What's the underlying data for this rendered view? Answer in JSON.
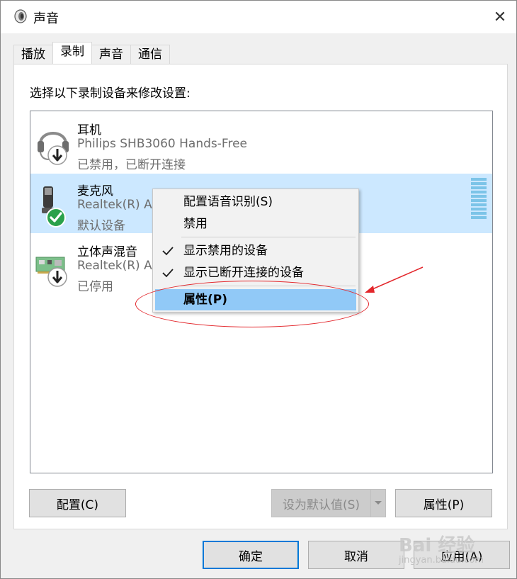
{
  "window": {
    "title": "声音",
    "title_icon": "speaker-icon",
    "close_glyph": "✕"
  },
  "tabs": [
    {
      "label": "播放"
    },
    {
      "label": "录制"
    },
    {
      "label": "声音"
    },
    {
      "label": "通信"
    }
  ],
  "panel": {
    "instruction": "选择以下录制设备来修改设置:"
  },
  "devices": [
    {
      "name": "耳机",
      "description": "Philips SHB3060 Hands-Free",
      "status": "已禁用，已断开连接",
      "icon": "headset-icon",
      "badge": "disabled-arrow-badge"
    },
    {
      "name": "麦克风",
      "description": "Realtek(R) A",
      "status": "默认设备",
      "icon": "microphone-icon",
      "badge": "default-check-badge"
    },
    {
      "name": "立体声混音",
      "description": "Realtek(R) A",
      "status": "已停用",
      "icon": "sound-card-icon",
      "badge": "disabled-arrow-badge"
    }
  ],
  "context_menu": {
    "items": [
      {
        "label": "配置语音识别(S)",
        "checked": false
      },
      {
        "label": "禁用",
        "checked": false
      },
      {
        "label": "显示禁用的设备",
        "checked": true
      },
      {
        "label": "显示已断开连接的设备",
        "checked": true
      },
      {
        "label": "属性(P)",
        "checked": false,
        "bold": true,
        "highlighted": true
      }
    ]
  },
  "buttons": {
    "configure": "配置(C)",
    "set_default": "设为默认值(S)",
    "properties": "属性(P)",
    "ok": "确定",
    "cancel": "取消",
    "apply": "应用(A)"
  },
  "watermark": {
    "brand": "Bai 经验",
    "url": "jingyan.baidu.com"
  },
  "colors": {
    "selection": "#cce8ff",
    "menu_highlight": "#91c9f7",
    "annotation": "#e3262b",
    "primary_border": "#0078d7"
  }
}
